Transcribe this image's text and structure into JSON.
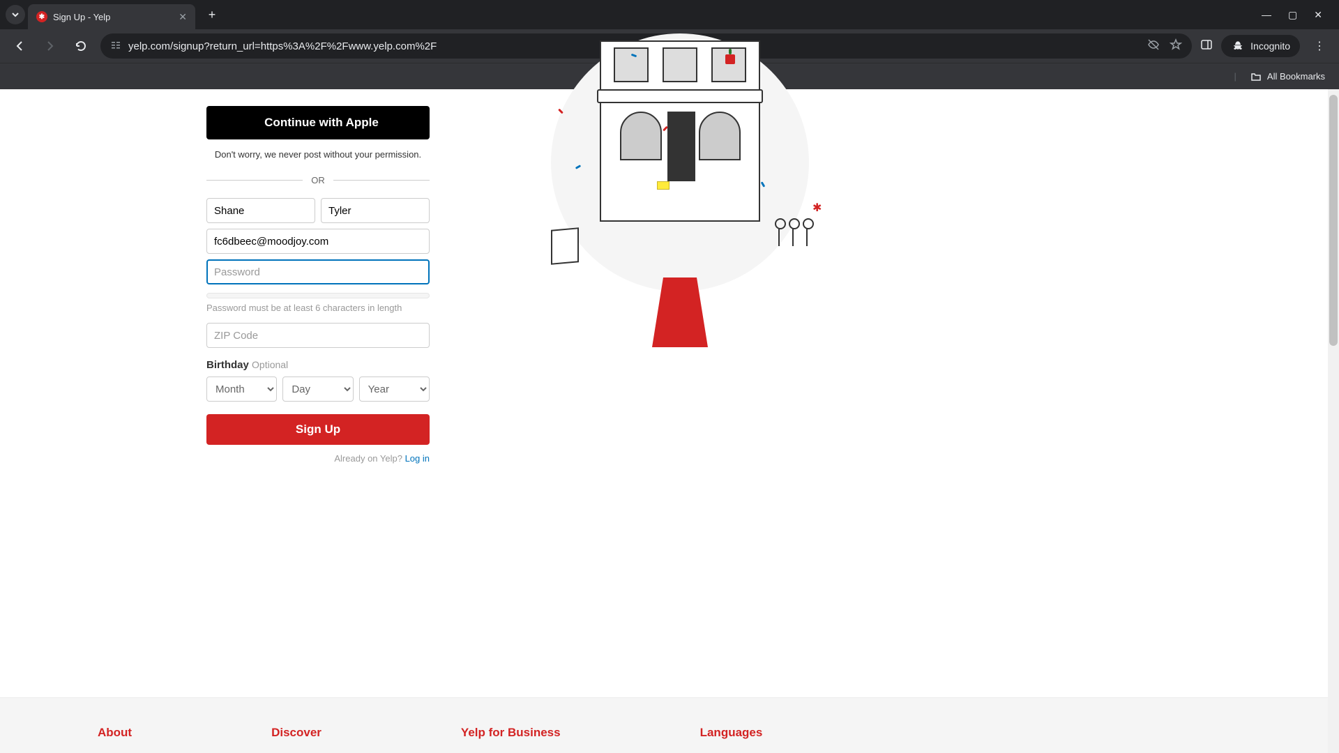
{
  "browser": {
    "tab_title": "Sign Up - Yelp",
    "url": "yelp.com/signup?return_url=https%3A%2F%2Fwww.yelp.com%2F",
    "incognito_label": "Incognito",
    "all_bookmarks": "All Bookmarks"
  },
  "signup": {
    "apple_button": "Continue with Apple",
    "permission_text": "Don't worry, we never post without your permission.",
    "or_label": "OR",
    "first_name_value": "Shane",
    "last_name_value": "Tyler",
    "email_value": "fc6dbeec@moodjoy.com",
    "password_placeholder": "Password",
    "password_hint": "Password must be at least 6 characters in length",
    "zip_placeholder": "ZIP Code",
    "birthday_label": "Birthday",
    "birthday_optional": "Optional",
    "month_option": "Month",
    "day_option": "Day",
    "year_option": "Year",
    "submit_label": "Sign Up",
    "already_text": "Already on Yelp? ",
    "login_link": "Log in"
  },
  "footer": {
    "col1": "About",
    "col2": "Discover",
    "col3": "Yelp for Business",
    "col4": "Languages"
  }
}
